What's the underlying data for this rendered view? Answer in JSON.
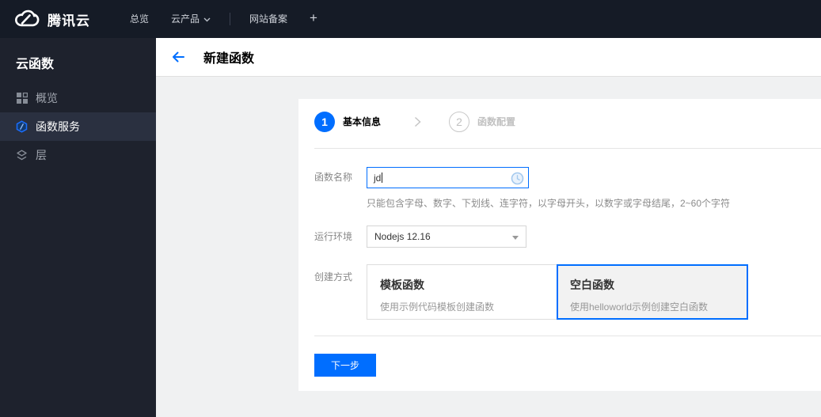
{
  "colors": {
    "accent_blue": "#006eff",
    "topbar_bg": "#151b26",
    "sidebar_bg": "#1e222d",
    "sidebar_selected_bg": "#2a3040",
    "content_bg": "#f0f1f2",
    "pending_icon_blue": "#a4c9ee"
  },
  "topnav": {
    "brand": "腾讯云",
    "overview": "总览",
    "products": "云产品",
    "beian": "网站备案",
    "plus": "+"
  },
  "sidebar": {
    "title": "云函数",
    "items": [
      {
        "label": "概览",
        "icon": "grid-icon",
        "selected": false
      },
      {
        "label": "函数服务",
        "icon": "scf-hexagon-icon",
        "selected": true
      },
      {
        "label": "层",
        "icon": "layers-icon",
        "selected": false
      }
    ]
  },
  "header": {
    "title": "新建函数"
  },
  "steps": [
    {
      "num": "1",
      "label": "基本信息",
      "active": true
    },
    {
      "num": "2",
      "label": "函数配置",
      "active": false
    }
  ],
  "form": {
    "name_label": "函数名称",
    "name_value": "jd",
    "name_help": "只能包含字母、数字、下划线、连字符，以字母开头，以数字或字母结尾，2~60个字符",
    "runtime_label": "运行环境",
    "runtime_value": "Nodejs 12.16",
    "method_label": "创建方式",
    "methods": [
      {
        "title": "模板函数",
        "desc": "使用示例代码模板创建函数",
        "selected": false
      },
      {
        "title": "空白函数",
        "desc": "使用helloworld示例创建空白函数",
        "selected": true
      }
    ],
    "next_label": "下一步"
  }
}
